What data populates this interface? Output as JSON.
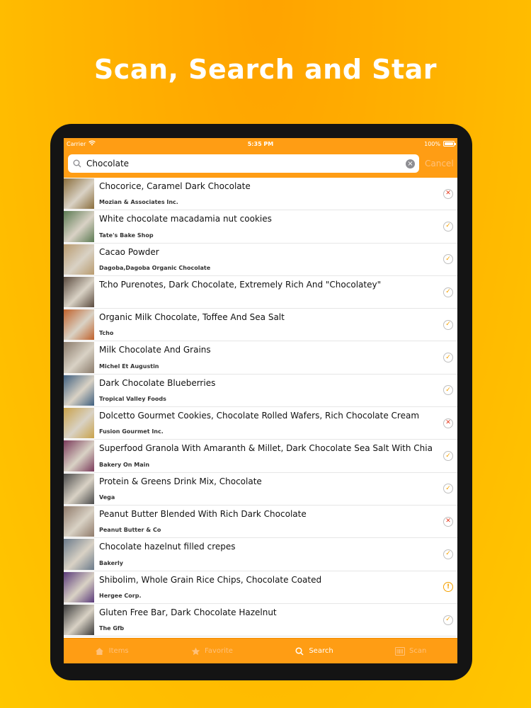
{
  "headline": "Scan, Search and Star",
  "status": {
    "carrier": "Carrier",
    "time": "5:35 PM",
    "battery": "100%"
  },
  "search": {
    "value": "Chocolate",
    "cancel": "Cancel"
  },
  "results": [
    {
      "title": "Chocorice, Caramel Dark Chocolate",
      "brand": "Mozian & Associates  Inc.",
      "badge": "x",
      "thumb": "#8a6d3b"
    },
    {
      "title": "White chocolate macadamia nut cookies",
      "brand": "Tate's Bake Shop",
      "badge": "check",
      "thumb": "#5b7a52"
    },
    {
      "title": "Cacao Powder",
      "brand": "Dagoba,Dagoba Organic Chocolate",
      "badge": "check",
      "thumb": "#b89a6e"
    },
    {
      "title": "Tcho Purenotes, Dark Chocolate, Extremely Rich And \"Chocolatey\"",
      "brand": "",
      "badge": "check",
      "thumb": "#5a4a3e"
    },
    {
      "title": "Organic Milk Chocolate, Toffee And Sea Salt",
      "brand": "Tcho",
      "badge": "check",
      "thumb": "#c0612b"
    },
    {
      "title": "Milk Chocolate And Grains",
      "brand": "Michel Et Augustin",
      "badge": "check",
      "thumb": "#8a7a6a"
    },
    {
      "title": "Dark Chocolate Blueberries",
      "brand": "Tropical Valley Foods",
      "badge": "check",
      "thumb": "#3f5f7f"
    },
    {
      "title": "Dolcetto Gourmet Cookies, Chocolate Rolled Wafers, Rich Chocolate Cream",
      "brand": "Fusion Gourmet  Inc.",
      "badge": "x",
      "thumb": "#c9a24a"
    },
    {
      "title": "Superfood Granola With Amaranth & Millet, Dark Chocolate Sea Salt With Chia",
      "brand": "Bakery On Main",
      "badge": "check",
      "thumb": "#7a3a5a"
    },
    {
      "title": "Protein & Greens Drink Mix, Chocolate",
      "brand": "Vega",
      "badge": "check",
      "thumb": "#4a4a4a"
    },
    {
      "title": "Peanut Butter Blended With Rich Dark Chocolate",
      "brand": "Peanut Butter & Co",
      "badge": "x",
      "thumb": "#8f7a6a"
    },
    {
      "title": "Chocolate hazelnut filled crepes",
      "brand": "Bakerly",
      "badge": "check",
      "thumb": "#6a7a8a"
    },
    {
      "title": "Shibolim, Whole Grain Rice Chips, Chocolate Coated",
      "brand": "Hergee Corp.",
      "badge": "warn",
      "thumb": "#5a3a7a"
    },
    {
      "title": "Gluten Free Bar, Dark Chocolate Hazelnut",
      "brand": "The Gfb",
      "badge": "check",
      "thumb": "#3a3a3a"
    }
  ],
  "tabs": [
    {
      "label": "Items",
      "icon": "home-icon",
      "active": false
    },
    {
      "label": "Favorite",
      "icon": "star-icon",
      "active": false
    },
    {
      "label": "Search",
      "icon": "search-icon",
      "active": true
    },
    {
      "label": "Scan",
      "icon": "barcode-icon",
      "active": false
    }
  ],
  "colors": {
    "accent": "#ff9d14",
    "check": "#f5a100",
    "x": "#e63a1e"
  }
}
